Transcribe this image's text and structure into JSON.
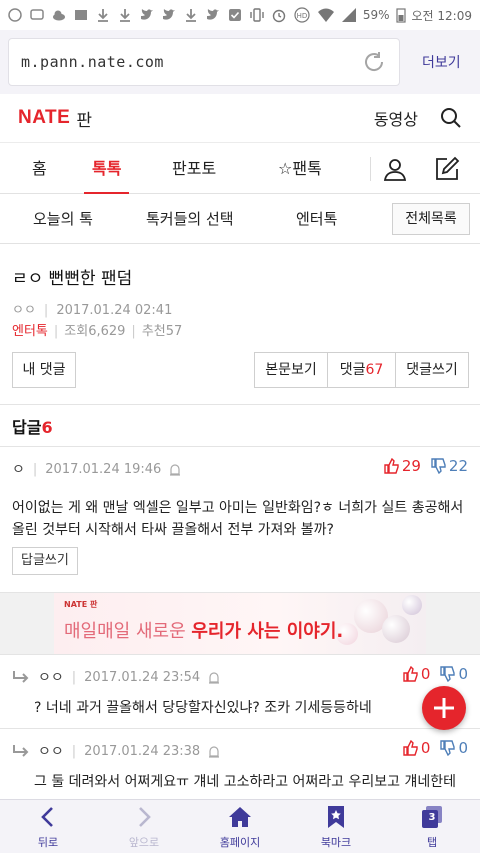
{
  "status_bar": {
    "battery": "59%",
    "time": "오전 12:09"
  },
  "browser": {
    "url": "m.pann.nate.com",
    "more_label": "더보기"
  },
  "header": {
    "logo_brand": "NATE",
    "logo_section": "판",
    "video_label": "동영상"
  },
  "tabs": {
    "home": "홈",
    "toktok": "톡톡",
    "panpoto": "판포토",
    "fantok": "☆팬톡"
  },
  "subtabs": {
    "today": "오늘의 톡",
    "choice": "톡커들의 선택",
    "enter": "엔터톡",
    "all": "전체목록"
  },
  "post": {
    "title": "ㄹㅇ 뻔뻔한 팬덤",
    "author": "ㅇㅇ",
    "date": "2017.01.24 02:41",
    "category": "엔터톡",
    "views": "조회6,629",
    "recommend": "추천57"
  },
  "actions": {
    "my_comments": "내 댓글",
    "view_body": "본문보기",
    "comments_label": "댓글",
    "comments_count": "67",
    "write_comment": "댓글쓰기"
  },
  "replies": {
    "label": "답글",
    "count": "6"
  },
  "comments": [
    {
      "author": "ㅇ",
      "date": "2017.01.24 19:46",
      "up": "29",
      "down": "22",
      "text": "어이없는 게 왜 맨날 엑셀은 일부고 아미는 일반화임?ㅎ 너희가 실트 총공해서 올린 것부터 시작해서 타싸 끌올해서 전부 가져와 볼까?",
      "reply_label": "답글쓰기"
    },
    {
      "author": "ㅇㅇ",
      "date": "2017.01.24 23:54",
      "up": "0",
      "down": "0",
      "text": "? 너네 과거 끌올해서 당당할자신있냐? 조카 기세등등하네"
    },
    {
      "author": "ㅇㅇ",
      "date": "2017.01.24 23:38",
      "up": "0",
      "down": "0",
      "text": "그 둘 데려와서 어쩌게요ㅠ 걔네 고소하라고 어쩌라고 우리보고 걔네한테"
    }
  ],
  "ad": {
    "logo": "NATE 판",
    "text_plain": "매일매일 새로운 ",
    "text_bold": "우리가 사는 이야기."
  },
  "bottom_nav": {
    "back": "뒤로",
    "forward": "앞으로",
    "home": "홈페이지",
    "bookmark": "북마크",
    "tabs": "탭",
    "tab_count": "3"
  },
  "colors": {
    "accent": "#e5252c",
    "browser_accent": "#3f3a9a",
    "downvote": "#4f7fb8"
  }
}
